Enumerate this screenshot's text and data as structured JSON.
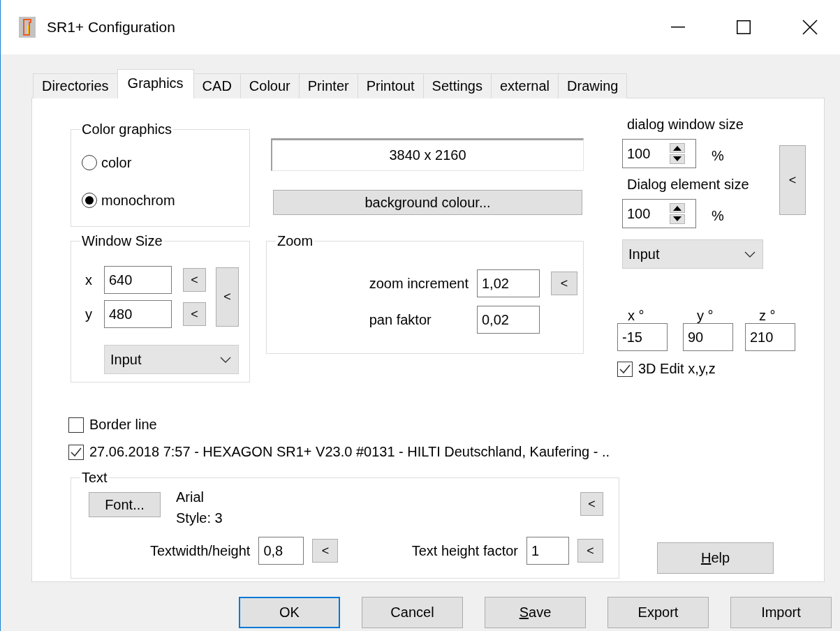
{
  "window": {
    "title": "SR1+ Configuration"
  },
  "tabs": [
    {
      "label": "Directories",
      "selected": false
    },
    {
      "label": "Graphics",
      "selected": true
    },
    {
      "label": "CAD",
      "selected": false
    },
    {
      "label": "Colour",
      "selected": false
    },
    {
      "label": "Printer",
      "selected": false
    },
    {
      "label": "Printout",
      "selected": false
    },
    {
      "label": "Settings",
      "selected": false
    },
    {
      "label": "external",
      "selected": false
    },
    {
      "label": "Drawing",
      "selected": false
    }
  ],
  "color_graphics": {
    "title": "Color graphics",
    "options": [
      {
        "label": "color",
        "selected": false
      },
      {
        "label": "monochrom",
        "selected": true
      }
    ]
  },
  "window_size": {
    "title": "Window Size",
    "fields": [
      {
        "label": "x",
        "value": "640",
        "button": "<"
      },
      {
        "label": "y",
        "value": "480",
        "button": "<"
      }
    ],
    "side_button": "<",
    "dropdown": "Input"
  },
  "resolution": "3840 x 2160",
  "background_button": "background colour...",
  "zoom": {
    "title": "Zoom",
    "fields": [
      {
        "label": "zoom increment",
        "value": "1,02",
        "button": "<"
      },
      {
        "label": "pan faktor",
        "value": "0,02"
      }
    ]
  },
  "scaling": {
    "spinners": [
      {
        "label": "dialog window size",
        "value": "100",
        "unit": "%"
      },
      {
        "label": "Dialog element size",
        "value": "100",
        "unit": "%"
      }
    ],
    "side_button": "<",
    "dropdown": "Input"
  },
  "angles": [
    {
      "label": "x °",
      "value": "-15"
    },
    {
      "label": "y °",
      "value": "90"
    },
    {
      "label": "z °",
      "value": "210"
    }
  ],
  "edit_3d": {
    "label": "3D Edit x,y,z",
    "checked": true
  },
  "border_line": {
    "label": "Border line",
    "checked": false
  },
  "stamp": {
    "label": "27.06.2018 7:57 - HEXAGON SR1+ V23.0 #0131 - HILTI Deutschland, Kaufering - ..",
    "checked": true
  },
  "text": {
    "title": "Text",
    "font_button": "Font...",
    "font_name": "Arial",
    "font_style": "Style: 3",
    "side_button": "<",
    "fields": [
      {
        "label": "Textwidth/height",
        "value": "0,8",
        "button": "<"
      },
      {
        "label": "Text height factor",
        "value": "1",
        "button": "<"
      }
    ]
  },
  "help_button": {
    "label": "Help",
    "mnemonic": true
  },
  "buttons": [
    {
      "label": "OK",
      "default": true,
      "mnemonic": false
    },
    {
      "label": "Cancel",
      "default": false,
      "mnemonic": false
    },
    {
      "label": "Save",
      "default": false,
      "mnemonic": true
    },
    {
      "label": "Export",
      "default": false,
      "mnemonic": false
    },
    {
      "label": "Import",
      "default": false,
      "mnemonic": false
    }
  ]
}
